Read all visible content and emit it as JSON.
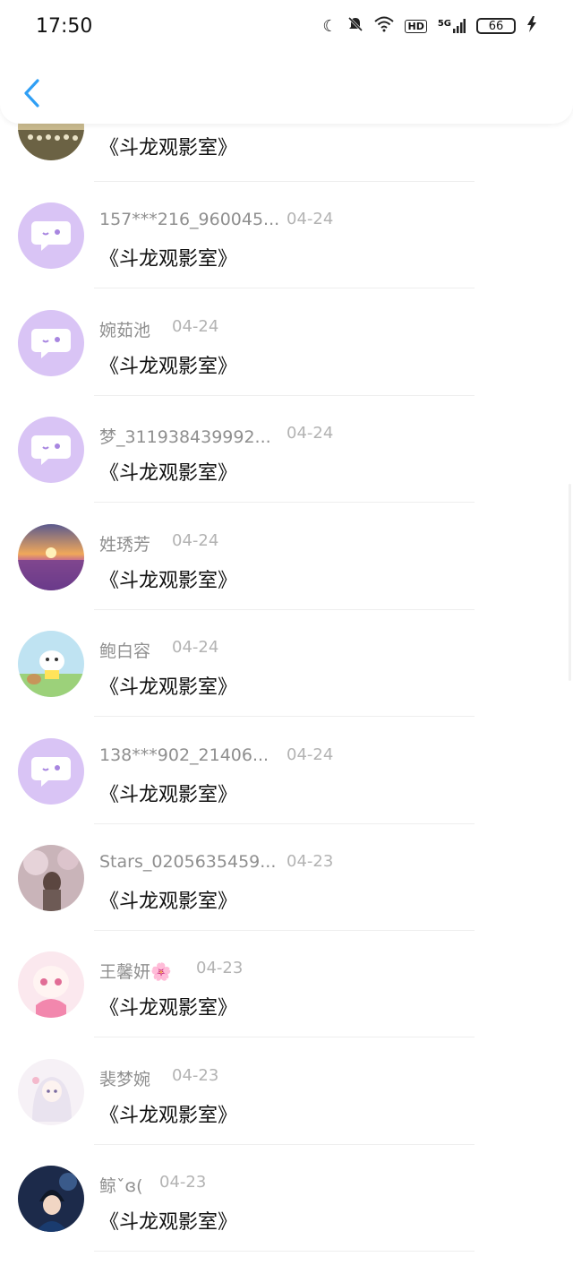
{
  "status_bar": {
    "time": "17:50",
    "hd": "HD",
    "network": "5G",
    "battery": "66"
  },
  "header": {
    "back_icon": "chevron-left-icon"
  },
  "partial_top_message": "《斗龙观影室》",
  "comments": [
    {
      "name": "157***216_960045...",
      "date": "04-24",
      "message": "《斗龙观影室》",
      "avatar": "default"
    },
    {
      "name": "婉茹池",
      "date": "04-24",
      "message": "《斗龙观影室》",
      "avatar": "default"
    },
    {
      "name": "梦_311938439992...",
      "date": "04-24",
      "message": "《斗龙观影室》",
      "avatar": "default"
    },
    {
      "name": "姓琇芳",
      "date": "04-24",
      "message": "《斗龙观影室》",
      "avatar": "lavender"
    },
    {
      "name": "鲍白容",
      "date": "04-24",
      "message": "《斗龙观影室》",
      "avatar": "cartoon"
    },
    {
      "name": "138***902_21406...",
      "date": "04-24",
      "message": "《斗龙观影室》",
      "avatar": "default"
    },
    {
      "name": "Stars_0205635459...",
      "date": "04-23",
      "message": "《斗龙观影室》",
      "avatar": "girl-photo"
    },
    {
      "name": "王馨妍🌸",
      "date": "04-23",
      "message": "《斗龙观影室》",
      "avatar": "anime-pink"
    },
    {
      "name": "裴梦婉",
      "date": "04-23",
      "message": "《斗龙观影室》",
      "avatar": "anime-white"
    },
    {
      "name": "鲸ˇɞ(",
      "date": "04-23",
      "message": "《斗龙观影室》",
      "avatar": "anime-dark"
    }
  ],
  "colors": {
    "accent_blue": "#2f9ff5",
    "default_avatar": "#d9c4f5",
    "name_gray": "#8f8f8f",
    "date_gray": "#b3b3b3"
  }
}
